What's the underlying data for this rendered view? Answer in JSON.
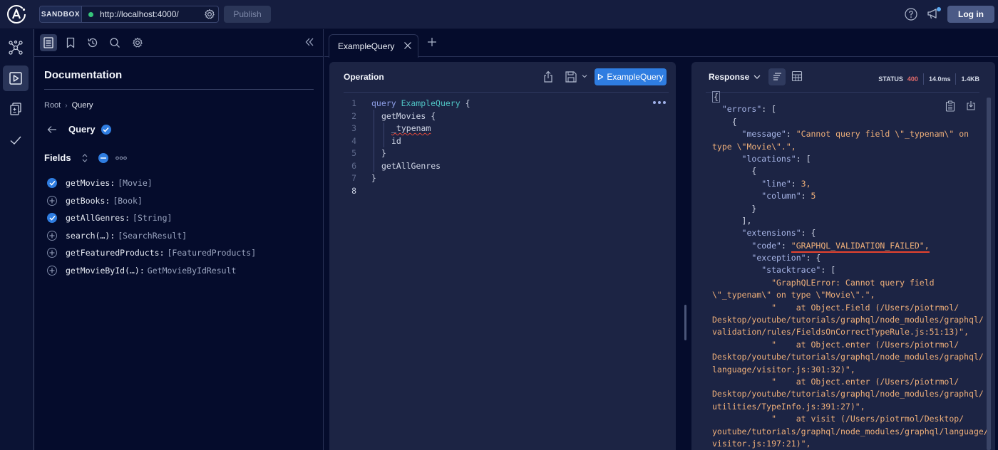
{
  "topbar": {
    "sandbox_label": "SANDBOX",
    "url": "http://localhost:4000/",
    "connection_status_color": "#36c57a",
    "publish_label": "Publish",
    "login_label": "Log in"
  },
  "leftnav": {
    "items": [
      {
        "name": "schema",
        "icon": "schema-graph-icon"
      },
      {
        "name": "explorer",
        "icon": "play-square-icon",
        "active": true
      },
      {
        "name": "changelog",
        "icon": "diff-icon"
      },
      {
        "name": "checks",
        "icon": "checkmark-icon"
      }
    ]
  },
  "docs": {
    "toolbar": [
      "documentation-icon",
      "bookmark-icon",
      "history-icon",
      "search-icon",
      "settings-icon"
    ],
    "title": "Documentation",
    "breadcrumb": {
      "root": "Root",
      "separator": "›",
      "current": "Query"
    },
    "type_title": "Query",
    "fields_label": "Fields",
    "fields": [
      {
        "name": "getMovies",
        "type": "[Movie]",
        "selected": true
      },
      {
        "name": "getBooks",
        "type": "[Book]",
        "selected": false
      },
      {
        "name": "getAllGenres",
        "type": "[String]",
        "selected": true
      },
      {
        "name": "search(…)",
        "type": "[SearchResult]",
        "selected": false
      },
      {
        "name": "getFeaturedProducts",
        "type": "[FeaturedProducts]",
        "selected": false
      },
      {
        "name": "getMovieById(…)",
        "type": "GetMovieByIdResult",
        "selected": false
      }
    ]
  },
  "tabs": [
    {
      "label": "ExampleQuery",
      "active": true
    }
  ],
  "operation": {
    "title": "Operation",
    "run_label": "ExampleQuery",
    "run_color": "#2f7de1",
    "lines": [
      {
        "n": "1",
        "keyword": "query",
        "name": "ExampleQuery",
        "rest": " {"
      },
      {
        "n": "2",
        "text": "getMovies {"
      },
      {
        "n": "3",
        "text": "_typenam",
        "error": true
      },
      {
        "n": "4",
        "text": "id"
      },
      {
        "n": "5",
        "text": "}"
      },
      {
        "n": "6",
        "text": "getAllGenres"
      },
      {
        "n": "7",
        "text": "}"
      },
      {
        "n": "8",
        "text": ""
      }
    ]
  },
  "response": {
    "title": "Response",
    "status_label": "STATUS",
    "status_code": "400",
    "status_color": "#e26b6b",
    "time": "14.0ms",
    "size": "1.4KB",
    "json_lines": [
      {
        "t": "{"
      },
      {
        "t": "  \"errors\": ["
      },
      {
        "t": "    {"
      },
      {
        "t": "      \"message\": \"Cannot query field \\\"_typenam\\\" on"
      },
      {
        "t": "type \\\"Movie\\\".\","
      },
      {
        "t": "      \"locations\": ["
      },
      {
        "t": "        {"
      },
      {
        "t": "          \"line\": 3,"
      },
      {
        "t": "          \"column\": 5"
      },
      {
        "t": "        }"
      },
      {
        "t": "      ],"
      },
      {
        "t": "      \"extensions\": {"
      },
      {
        "t": "        \"code\": \"GRAPHQL_VALIDATION_FAILED\","
      },
      {
        "t": "        \"exception\": {"
      },
      {
        "t": "          \"stacktrace\": ["
      },
      {
        "t": "            \"GraphQLError: Cannot query field"
      },
      {
        "t": "\\\"_typenam\\\" on type \\\"Movie\\\".\","
      },
      {
        "t": "            \"    at Object.Field (/Users/piotrmol/"
      },
      {
        "t": "Desktop/youtube/tutorials/graphql/node_modules/graphql/"
      },
      {
        "t": "validation/rules/FieldsOnCorrectTypeRule.js:51:13)\","
      },
      {
        "t": "            \"    at Object.enter (/Users/piotrmol/"
      },
      {
        "t": "Desktop/youtube/tutorials/graphql/node_modules/graphql/"
      },
      {
        "t": "language/visitor.js:301:32)\","
      },
      {
        "t": "            \"    at Object.enter (/Users/piotrmol/"
      },
      {
        "t": "Desktop/youtube/tutorials/graphql/node_modules/graphql/"
      },
      {
        "t": "utilities/TypeInfo.js:391:27)\","
      },
      {
        "t": "            \"    at visit (/Users/piotrmol/Desktop/"
      },
      {
        "t": "youtube/tutorials/graphql/node_modules/graphql/language/"
      },
      {
        "t": "visitor.js:197:21)\","
      }
    ],
    "highlight_color": "#e8432e"
  }
}
